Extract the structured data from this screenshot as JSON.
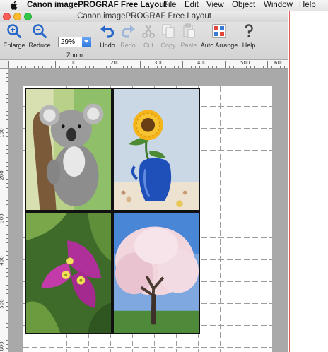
{
  "menubar": {
    "app_name": "Canon imagePROGRAF Free Layout",
    "items": [
      "File",
      "Edit",
      "View",
      "Object",
      "Window",
      "Help"
    ]
  },
  "window": {
    "title": "Canon imagePROGRAF Free Layout"
  },
  "toolbar": {
    "enlarge": "Enlarge",
    "reduce": "Reduce",
    "zoom_label": "Zoom",
    "zoom_value": "29%",
    "undo": "Undo",
    "redo": "Redo",
    "cut": "Cut",
    "copy": "Copy",
    "paste": "Paste",
    "auto_arrange": "Auto Arrange",
    "help": "Help"
  },
  "ruler": {
    "top_labels": [
      "100",
      "200",
      "300",
      "400",
      "500",
      "600"
    ],
    "left_labels": [
      "100",
      "200",
      "300",
      "400",
      "500",
      "600"
    ]
  },
  "photos": [
    {
      "subject": "koala"
    },
    {
      "subject": "sunflower-in-blue-vase"
    },
    {
      "subject": "bougainvillea-flower"
    },
    {
      "subject": "cherry-blossom-tree"
    }
  ],
  "colors": {
    "accent_blue": "#2c76e0",
    "close": "#fc5f57",
    "minimize": "#fdbb2e",
    "maximize": "#33c748",
    "workspace": "#a9a9a9"
  }
}
